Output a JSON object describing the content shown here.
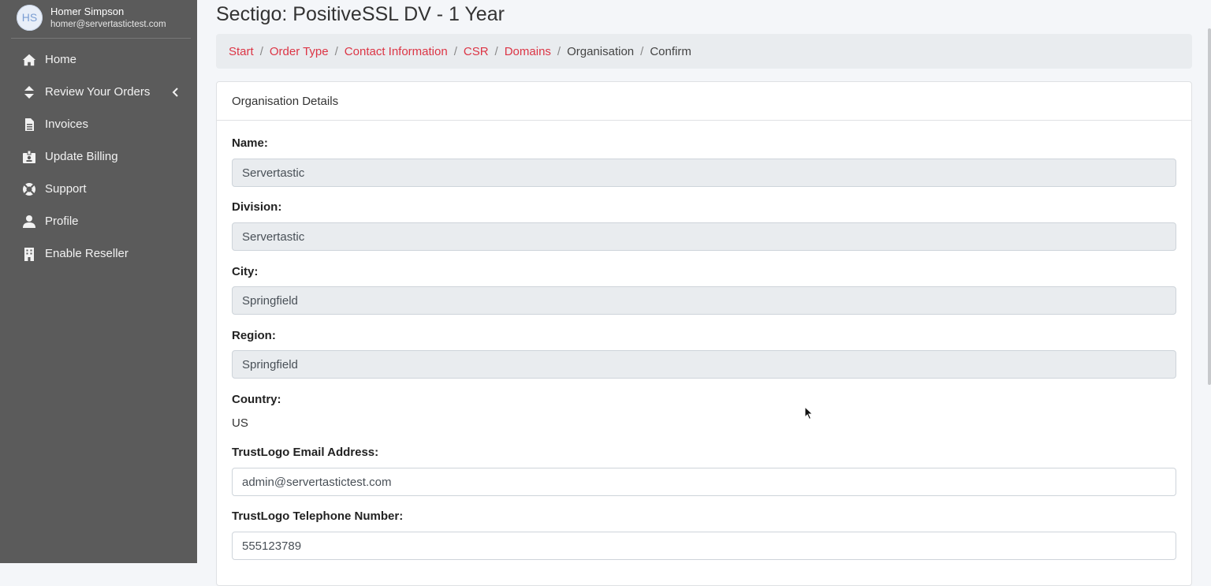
{
  "user": {
    "initials": "HS",
    "name": "Homer Simpson",
    "email": "homer@servertastictest.com"
  },
  "sidebar": {
    "items": [
      {
        "label": "Home",
        "icon": "home-icon"
      },
      {
        "label": "Review Your Orders",
        "icon": "sort-icon"
      },
      {
        "label": "Invoices",
        "icon": "file-icon"
      },
      {
        "label": "Update Billing",
        "icon": "id-badge-icon"
      },
      {
        "label": "Support",
        "icon": "life-ring-icon"
      },
      {
        "label": "Profile",
        "icon": "user-icon"
      },
      {
        "label": "Enable Reseller",
        "icon": "building-icon"
      }
    ]
  },
  "page": {
    "title": "Sectigo: PositiveSSL DV - 1 Year"
  },
  "breadcrumb": {
    "items": [
      "Start",
      "Order Type",
      "Contact Information",
      "CSR",
      "Domains",
      "Organisation",
      "Confirm"
    ]
  },
  "card": {
    "header": "Organisation Details",
    "fields": {
      "name": {
        "label": "Name:",
        "value": "Servertastic"
      },
      "division": {
        "label": "Division:",
        "value": "Servertastic"
      },
      "city": {
        "label": "City:",
        "value": "Springfield"
      },
      "region": {
        "label": "Region:",
        "value": "Springfield"
      },
      "country": {
        "label": "Country:",
        "value": "US"
      },
      "trustlogo_email": {
        "label": "TrustLogo Email Address:",
        "value": "admin@servertastictest.com"
      },
      "trustlogo_phone": {
        "label": "TrustLogo Telephone Number:",
        "value": "555123789"
      }
    }
  },
  "colors": {
    "sidebar_bg": "#5b5b5b",
    "link_red": "#dc3545",
    "readonly_bg": "#e9ecef"
  }
}
